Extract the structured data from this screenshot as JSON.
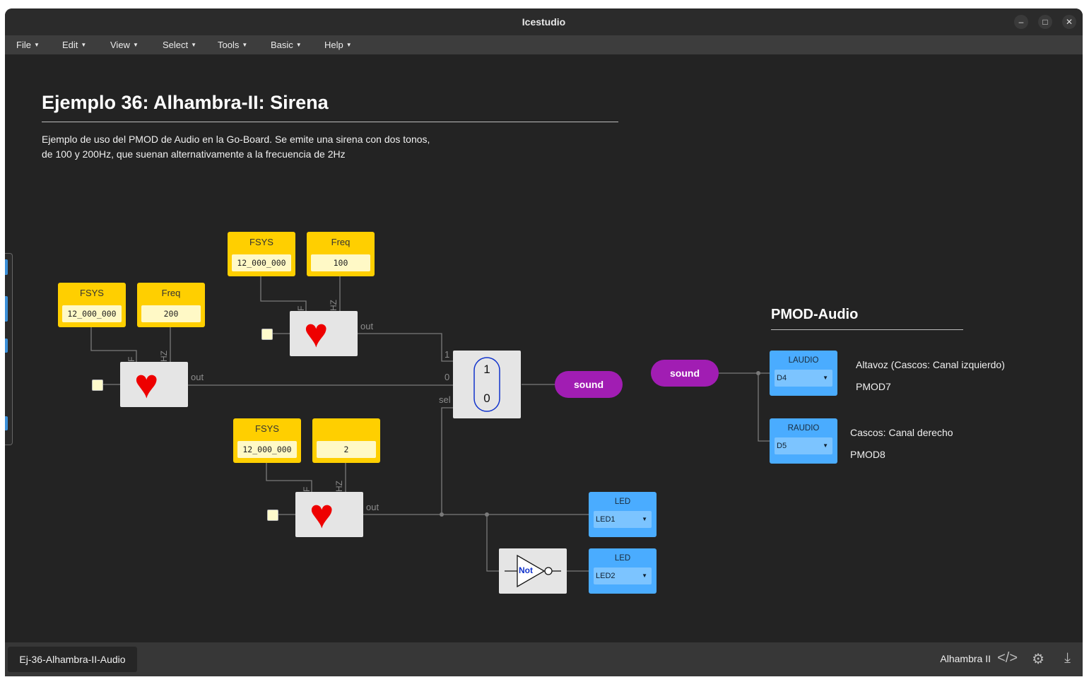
{
  "window": {
    "title": "Icestudio"
  },
  "menu": [
    {
      "label": "File"
    },
    {
      "label": "Edit"
    },
    {
      "label": "View"
    },
    {
      "label": "Select"
    },
    {
      "label": "Tools"
    },
    {
      "label": "Basic"
    },
    {
      "label": "Help"
    }
  ],
  "canvas": {
    "title": "Ejemplo 36: Alhambra-II: Sirena",
    "description_line1": "Ejemplo de uso del PMOD de Audio en la Go-Board. Se emite una sirena con dos tonos,",
    "description_line2": "de 100 y 200Hz, que suenan alternativamente a la frecuencia de 2Hz",
    "pmod_title": "PMOD-Audio",
    "note_left_channel": "Altavoz (Cascos: Canal izquierdo)",
    "note_pmod7": "PMOD7",
    "note_right_channel": "Cascos: Canal derecho",
    "note_pmod8": "PMOD8"
  },
  "blocks": {
    "c1": {
      "label": "FSYS",
      "value": "12_000_000"
    },
    "c2": {
      "label": "Freq",
      "value": "100"
    },
    "c3": {
      "label": "FSYS",
      "value": "12_000_000"
    },
    "c4": {
      "label": "Freq",
      "value": "200"
    },
    "c5": {
      "label": "FSYS",
      "value": "12_000_000"
    },
    "c6": {
      "label": "",
      "value": "2"
    },
    "mux": {
      "in1": "1",
      "in0": "0"
    },
    "sound_out": "sound",
    "sound_in": "sound",
    "laudio": {
      "label": "LAUDIO",
      "pin": "D4"
    },
    "raudio": {
      "label": "RAUDIO",
      "pin": "D5"
    },
    "led1": {
      "label": "LED",
      "pin": "LED1"
    },
    "led2": {
      "label": "LED",
      "pin": "LED2"
    },
    "not_gate": "Not",
    "port_f": "F",
    "port_hz": "HZ",
    "port_out": "out",
    "port_sel": "sel",
    "port_1": "1",
    "port_0": "0"
  },
  "status": {
    "file_tab": "Ej-36-Alhambra-II-Audio",
    "board": "Alhambra II"
  },
  "colors": {
    "constant": "#ffcf00",
    "pin": "#4aacff",
    "label_pill": "#a11db3",
    "canvas": "#232323",
    "heart": "#ee0000"
  }
}
